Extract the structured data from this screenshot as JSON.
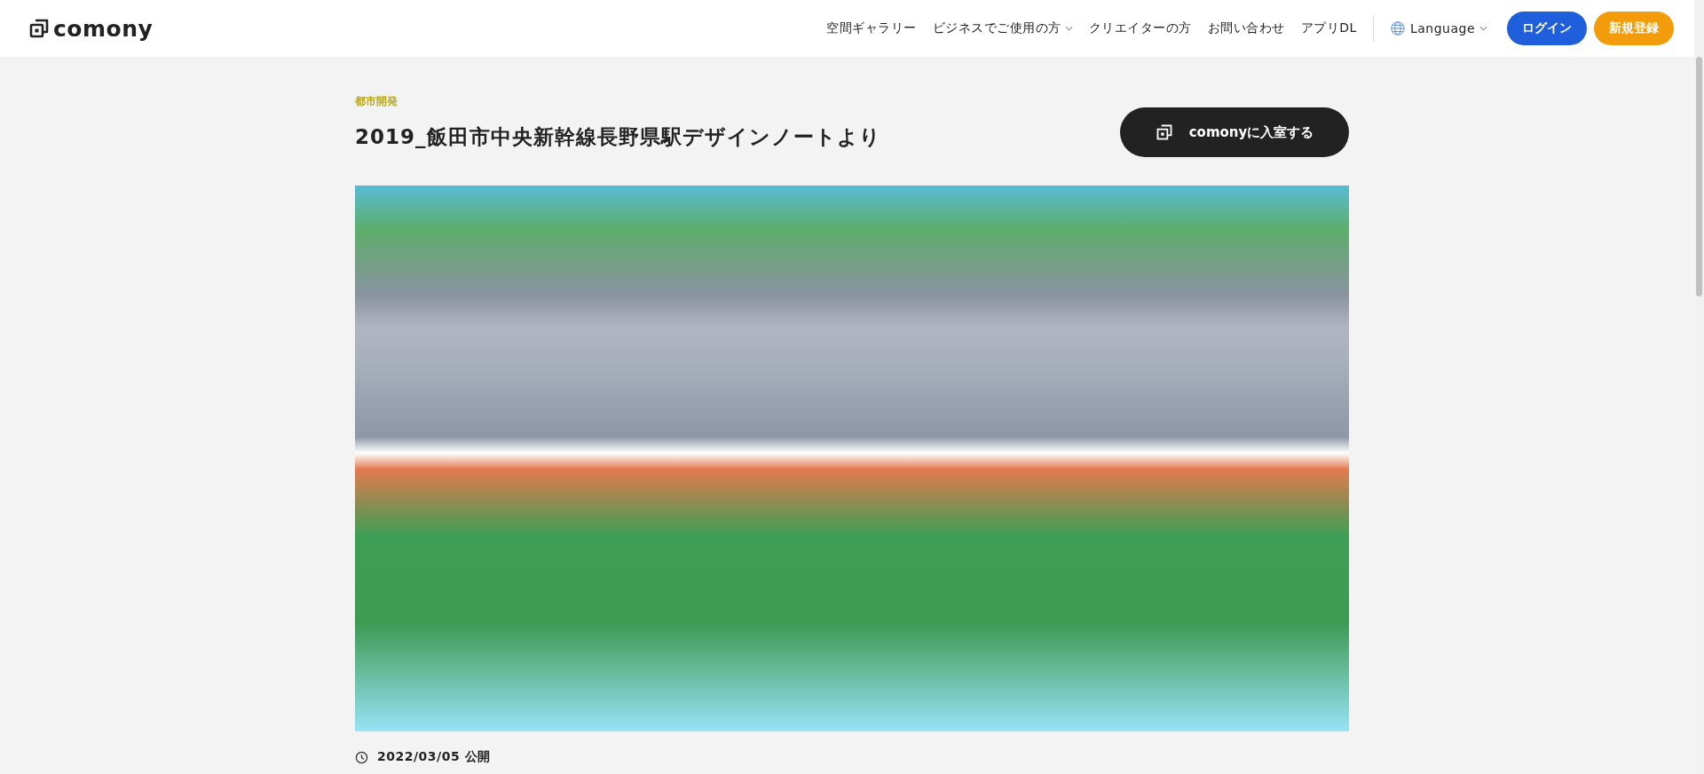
{
  "header": {
    "logo_text": "comony",
    "nav": [
      {
        "label": "空間ギャラリー",
        "kind": "link"
      },
      {
        "label": "ビジネスでご使用の方",
        "kind": "dropdown"
      },
      {
        "label": "クリエイターの方",
        "kind": "link"
      },
      {
        "label": "お問い合わせ",
        "kind": "link"
      },
      {
        "label": "アプリDL",
        "kind": "link"
      }
    ],
    "language": "Language",
    "buttons": [
      {
        "label": "ログイン",
        "kind": "primary"
      },
      {
        "label": "新規登録",
        "kind": "accent"
      }
    ]
  },
  "article": {
    "category": "都市開発",
    "title": "2019_飯田市中央新幹線長野県駅デザインノートより",
    "enter_button": "comonyに入室する",
    "published": "2022/03/05 公開"
  }
}
